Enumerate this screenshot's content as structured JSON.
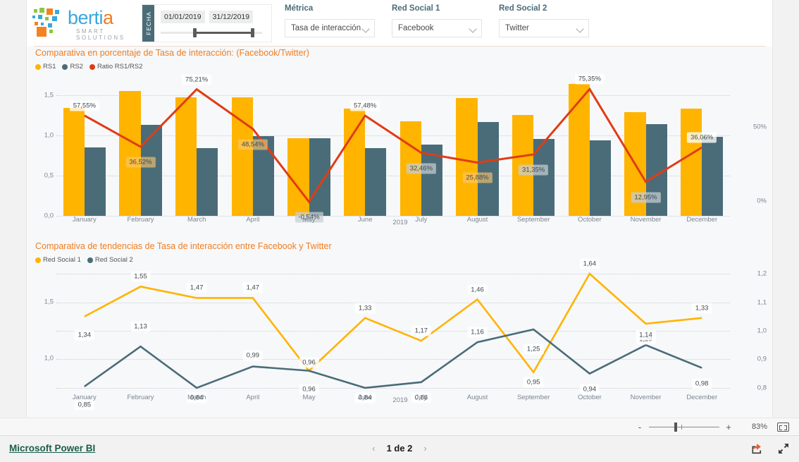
{
  "brand": {
    "name": "bertia",
    "name_prefix": "berti",
    "name_suffix": "a",
    "tagline": "SMART SOLUTIONS"
  },
  "filters": {
    "date": {
      "tab_label": "FECHA",
      "start": "01/01/2019",
      "end": "31/12/2019"
    },
    "metrica": {
      "label": "Métrica",
      "value": "Tasa de interacción"
    },
    "red_social_1": {
      "label": "Red Social 1",
      "value": "Facebook"
    },
    "red_social_2": {
      "label": "Red Social 2",
      "value": "Twitter"
    }
  },
  "colors": {
    "rs1": "#FFB400",
    "rs2": "#4A6C78",
    "ratio": "#E03C14",
    "title": "#f07d20",
    "link": "#1b5e4b"
  },
  "chart_data": [
    {
      "type": "bar",
      "title": "Comparativa en porcentaje de Tasa de interacción: (Facebook/Twitter)",
      "xlabel": "2019",
      "ylabel": "",
      "categories": [
        "January",
        "February",
        "March",
        "April",
        "May",
        "June",
        "July",
        "August",
        "September",
        "October",
        "November",
        "December"
      ],
      "ylim": [
        0,
        1.75
      ],
      "yticks": [
        "0,0",
        "0,5",
        "1,0",
        "1,5"
      ],
      "y2lim": [
        -10,
        85
      ],
      "y2ticks": [
        "0%",
        "50%"
      ],
      "grid": true,
      "legend": [
        "RS1",
        "RS2",
        "Ratio RS1/RS2"
      ],
      "legend_position": "top-left",
      "series": [
        {
          "name": "RS1",
          "type": "bar",
          "values": [
            1.34,
            1.55,
            1.47,
            1.47,
            0.96,
            1.33,
            1.17,
            1.46,
            1.25,
            1.64,
            1.29,
            1.33
          ]
        },
        {
          "name": "RS2",
          "type": "bar",
          "values": [
            0.85,
            1.13,
            0.84,
            0.99,
            0.96,
            0.84,
            0.88,
            1.16,
            0.95,
            0.94,
            1.14,
            0.98
          ]
        },
        {
          "name": "Ratio RS1/RS2",
          "type": "line",
          "values": [
            57.55,
            36.52,
            75.21,
            48.54,
            -0.54,
            57.48,
            32.46,
            25.88,
            31.35,
            75.35,
            12.95,
            36.06
          ],
          "labels": [
            "57,55%",
            "36,52%",
            "75,21%",
            "48,54%",
            "-0,54%",
            "57,48%",
            "32,46%",
            "25,88%",
            "31,35%",
            "75,35%",
            "12,95%",
            "36,06%"
          ]
        }
      ]
    },
    {
      "type": "line",
      "title": "Comparativa de tendencias de Tasa de interacción entre Facebook y Twitter",
      "xlabel": "2019",
      "ylabel": "",
      "categories": [
        "January",
        "February",
        "March",
        "April",
        "May",
        "June",
        "July",
        "August",
        "September",
        "October",
        "November",
        "December"
      ],
      "ylim": [
        0.78,
        1.22
      ],
      "yticks": [
        "1,0",
        "1,5"
      ],
      "y2ticks": [
        "0,8",
        "0,9",
        "1,0",
        "1,1",
        "1,2"
      ],
      "grid": true,
      "legend": [
        "Red Social 1",
        "Red Social 2"
      ],
      "legend_position": "top-left",
      "series": [
        {
          "name": "Red Social 1",
          "values": [
            1.34,
            1.55,
            1.47,
            1.47,
            0.96,
            1.33,
            1.17,
            1.46,
            0.95,
            1.64,
            1.29,
            1.33
          ],
          "labels": [
            "1,34",
            "1,55",
            "1,47",
            "1,47",
            "0,96",
            "1,33",
            "1,17",
            "1,46",
            "0,95",
            "1,64",
            "1,29",
            "1,33"
          ]
        },
        {
          "name": "Red Social 2",
          "values": [
            0.85,
            1.13,
            0.84,
            0.99,
            0.96,
            0.84,
            0.88,
            1.16,
            1.25,
            0.94,
            1.14,
            0.98
          ],
          "labels": [
            "0,85",
            "1,13",
            "0,84",
            "0,99",
            "0,96",
            "0,84",
            "0,88",
            "1,16",
            "1,25",
            "0,94",
            "1,14",
            "0,98"
          ]
        }
      ]
    }
  ],
  "statusbar": {
    "zoom_level": "83%",
    "minus": "-",
    "plus": "+"
  },
  "footer": {
    "brand_link": "Microsoft Power BI",
    "page_indicator": "1 de 2",
    "prev": "‹",
    "next": "›"
  }
}
